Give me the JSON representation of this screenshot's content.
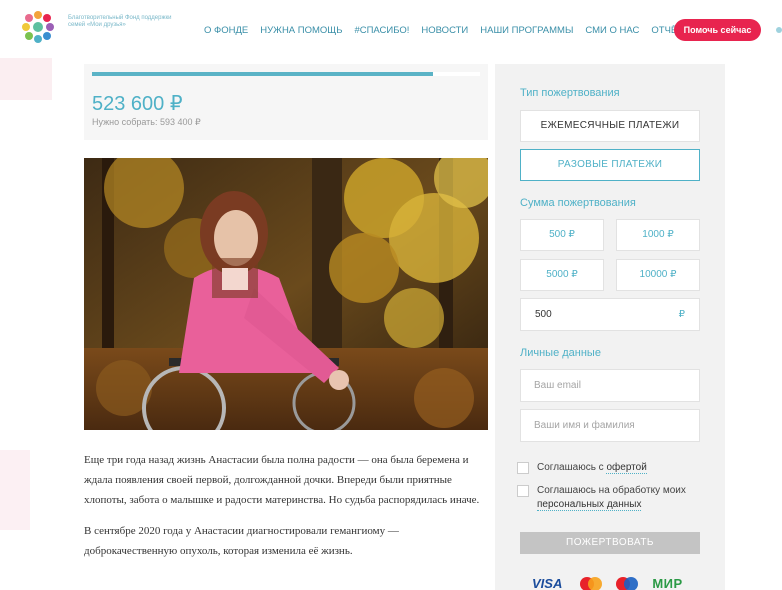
{
  "header": {
    "logo_text": "Благотворительный Фонд поддержки семей «Мои друзья»",
    "nav": [
      "О ФОНДЕ",
      "НУЖНА ПОМОЩЬ",
      "#СПАСИБО!",
      "НОВОСТИ",
      "НАШИ ПРОГРАММЫ",
      "СМИ О НАС",
      "ОТЧЁТЫ"
    ],
    "help_button": "Помочь сейчас"
  },
  "fundraising": {
    "raised": "523 600 ₽",
    "target_label": "Нужно собрать: 593 400 ₽",
    "progress_fraction": 0.88
  },
  "story": {
    "paragraph1": "Еще три года назад жизнь Анастасии была полна радости — она была беремена и ждала появления своей первой, долгожданной дочки. Впереди были приятные хлопоты, забота о малышке и радости материнства. Но судьба распорядилась иначе.",
    "paragraph2": "В сентябре 2020 года у Анастасии диагностировали гемангиому — доброкачественную опухоль, которая изменила её жизнь."
  },
  "donation_form": {
    "type_title": "Тип пожертвования",
    "monthly_label": "ЕЖЕМЕСЯЧНЫЕ ПЛАТЕЖИ",
    "onetime_label": "РАЗОВЫЕ ПЛАТЕЖИ",
    "amount_title": "Сумма пожертвования",
    "amounts": [
      "500 ₽",
      "1000 ₽",
      "5000 ₽",
      "10000 ₽"
    ],
    "amount_value": "500",
    "currency": "₽",
    "personal_title": "Личные данные",
    "email_placeholder": "Ваш email",
    "name_placeholder": "Ваши имя и фамилия",
    "offer_prefix": "Соглашаюсь с ",
    "offer_link": "офертой",
    "pd_prefix": "Соглашаюсь на обработку моих",
    "pd_link": "персональных данных",
    "donate_button": "ПОЖЕРТВОВАТЬ"
  },
  "payment_logos": {
    "visa": "VISA",
    "mir": "МИР"
  },
  "colors": {
    "accent": "#4fb1c7",
    "help_button": "#e8244f",
    "panel_bg": "#f2f2f2"
  }
}
